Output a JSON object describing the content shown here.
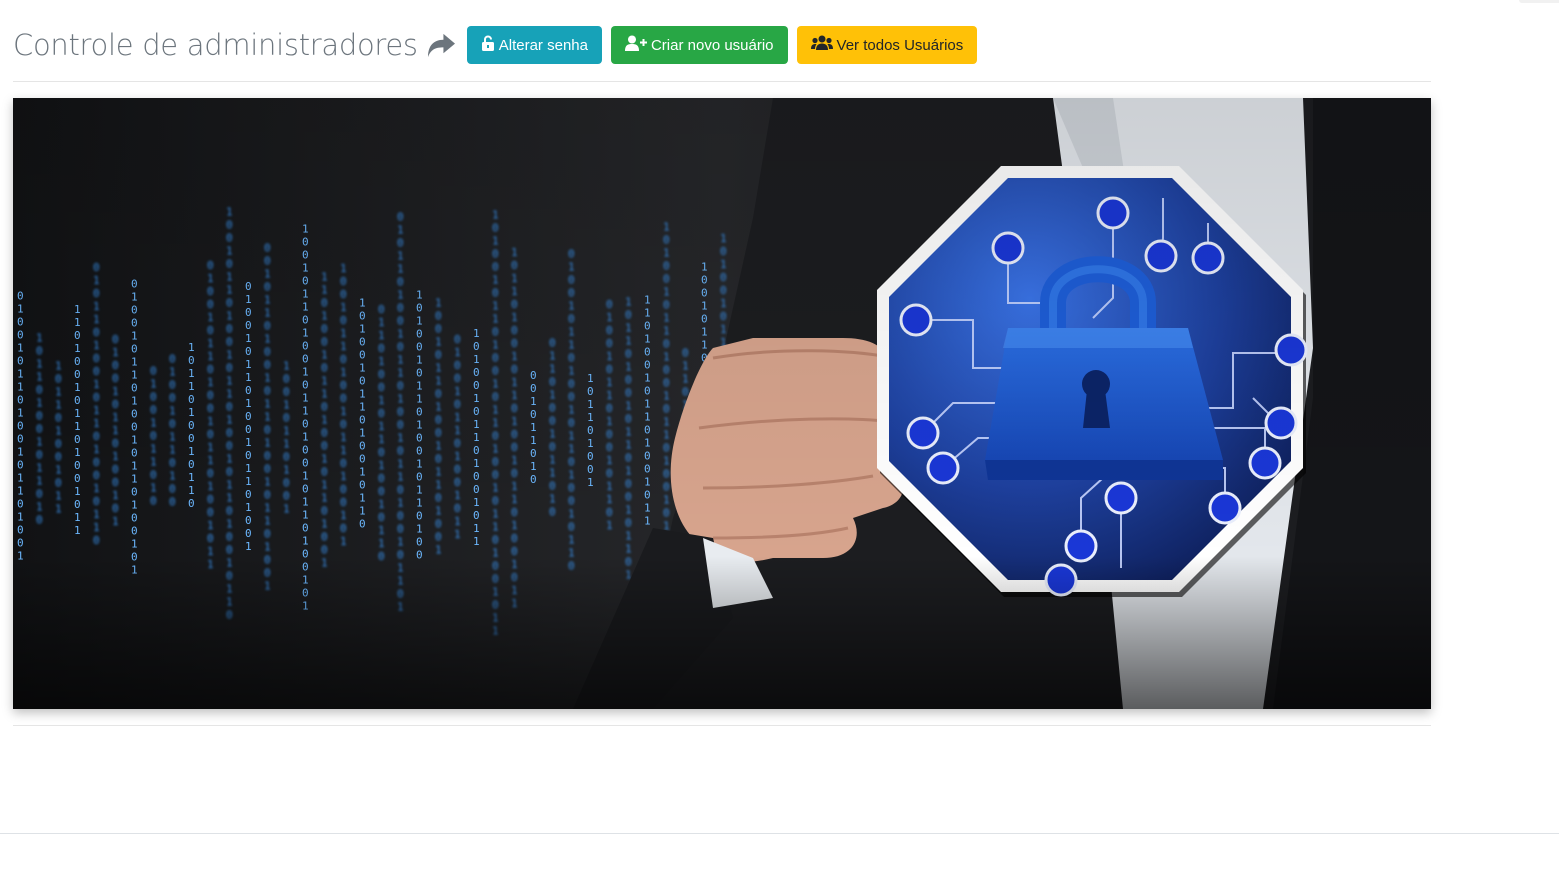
{
  "header": {
    "title": "Controle de administradores",
    "title_icon": "share-arrow-icon"
  },
  "buttons": {
    "change_password": {
      "label": "Alterar senha",
      "icon": "unlock-icon",
      "color": "#17a2b8"
    },
    "create_user": {
      "label": "Criar novo usuário",
      "icon": "user-plus-icon",
      "color": "#28a745"
    },
    "view_users": {
      "label": "Ver todos Usuários",
      "icon": "users-icon",
      "color": "#ffc107"
    }
  },
  "banner": {
    "image": "security-padlock-circuit-banner",
    "binary_digits": "1010010110100101101001011010010110100101101001011010"
  }
}
